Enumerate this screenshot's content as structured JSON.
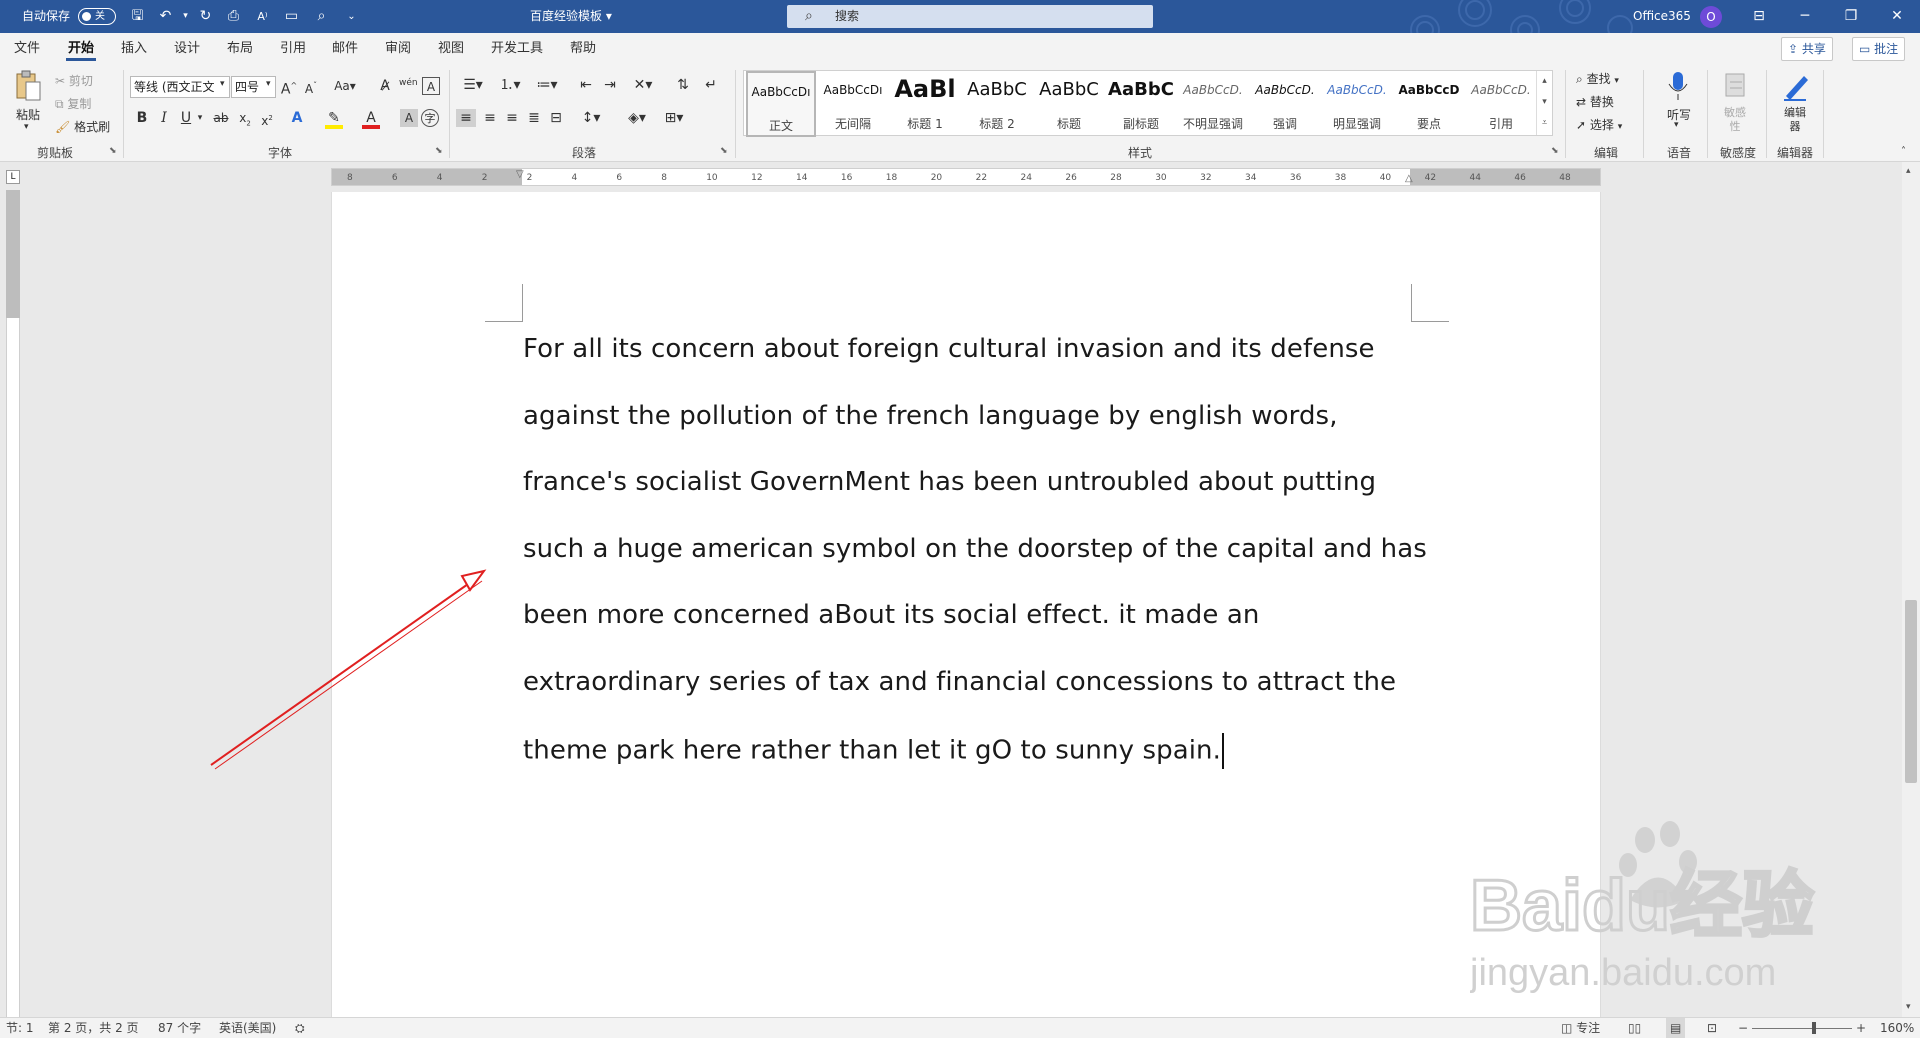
{
  "titlebar": {
    "autosave_label": "自动保存",
    "autosave_state": "关",
    "doc_title": "百度经验模板",
    "search_placeholder": "搜索",
    "account": "Office365",
    "avatar_initial": "O"
  },
  "tabs": [
    "文件",
    "开始",
    "插入",
    "设计",
    "布局",
    "引用",
    "邮件",
    "审阅",
    "视图",
    "开发工具",
    "帮助"
  ],
  "active_tab": "开始",
  "share_label": "共享",
  "comment_label": "批注",
  "clipboard": {
    "paste": "粘贴",
    "cut": "剪切",
    "copy": "复制",
    "format_painter": "格式刷",
    "group": "剪贴板"
  },
  "font": {
    "name": "等线 (西文正文",
    "size": "四号",
    "group": "字体"
  },
  "paragraph_group": "段落",
  "styles": {
    "group": "样式",
    "items": [
      {
        "preview": "AaBbCcDı",
        "name": "正文"
      },
      {
        "preview": "AaBbCcDı",
        "name": "无间隔"
      },
      {
        "preview": "AaBl",
        "name": "标题 1"
      },
      {
        "preview": "AaBbC",
        "name": "标题 2"
      },
      {
        "preview": "AaBbC",
        "name": "标题"
      },
      {
        "preview": "AaBbC",
        "name": "副标题"
      },
      {
        "preview": "AaBbCcD.",
        "name": "不明显强调"
      },
      {
        "preview": "AaBbCcD.",
        "name": "强调"
      },
      {
        "preview": "AaBbCcD.",
        "name": "明显强调"
      },
      {
        "preview": "AaBbCcD",
        "name": "要点"
      },
      {
        "preview": "AaBbCcD.",
        "name": "引用"
      }
    ]
  },
  "editing": {
    "find": "查找",
    "replace": "替换",
    "select": "选择",
    "group": "编辑"
  },
  "voice": {
    "dictate": "听写",
    "group": "语音"
  },
  "sensitivity": {
    "label": "敏感性",
    "group": "敏感度"
  },
  "editor": {
    "label": "编辑器",
    "group": "编辑器"
  },
  "ruler_numbers": [
    "8",
    "6",
    "4",
    "2",
    "2",
    "4",
    "6",
    "8",
    "10",
    "12",
    "14",
    "16",
    "18",
    "20",
    "22",
    "24",
    "26",
    "28",
    "30",
    "32",
    "34",
    "36",
    "38",
    "40",
    "42",
    "44",
    "46",
    "48"
  ],
  "document": {
    "lines": [
      "For all its concern about foreign cultural invasion and its defense",
      "against the pollution of the french language by english words,",
      "france's socialist GovernMent has been untroubled about putting",
      "such a huge american symbol on the doorstep of the capital and has",
      "been more concerned aBout its social effect. it made an",
      "extraordinary series of tax and financial concessions to attract the",
      "theme park here rather than let it gO to sunny spain."
    ]
  },
  "status": {
    "section": "节: 1",
    "page": "第 2 页，共 2 页",
    "words": "87 个字",
    "language": "英语(美国)",
    "focus": "专注",
    "zoom": "160%"
  },
  "watermark": {
    "brand": "Baidu经验",
    "url": "jingyan.baidu.com"
  },
  "colors": {
    "accent": "#2b579a",
    "arrow": "#e02020"
  }
}
